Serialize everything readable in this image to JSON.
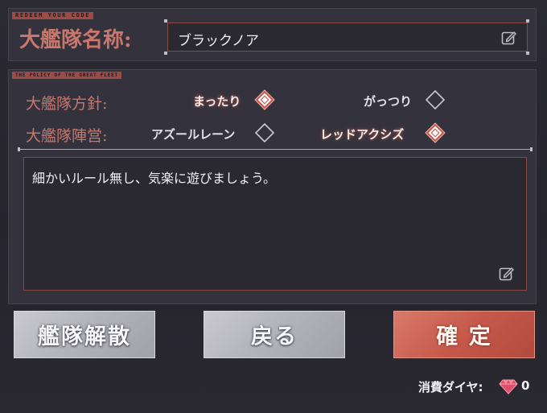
{
  "header": {
    "tag": "REDEEM YOUR CODE",
    "name_label": "大艦隊名称:",
    "name_value": "ブラックノア"
  },
  "policy": {
    "tag": "THE POLICY OF THE GREAT FLEET",
    "policy_label": "大艦隊方針:",
    "policy_options": [
      {
        "label": "まったり",
        "selected": true
      },
      {
        "label": "がっつり",
        "selected": false
      }
    ],
    "camp_label": "大艦隊陣営:",
    "camp_options": [
      {
        "label": "アズールレーン",
        "selected": false
      },
      {
        "label": "レッドアクシズ",
        "selected": true
      }
    ]
  },
  "description": {
    "text": "細かいルール無し、気楽に遊びましょう。"
  },
  "buttons": {
    "disband": "艦隊解散",
    "back": "戻る",
    "confirm": "確 定"
  },
  "cost": {
    "label": "消費ダイヤ:",
    "value": "0"
  },
  "colors": {
    "accent_red": "#c6594a",
    "label_red": "#c9776c",
    "gem_red": "#e0506a"
  },
  "icons": [
    "edit-icon",
    "diamond-radio-icon",
    "gem-icon"
  ]
}
